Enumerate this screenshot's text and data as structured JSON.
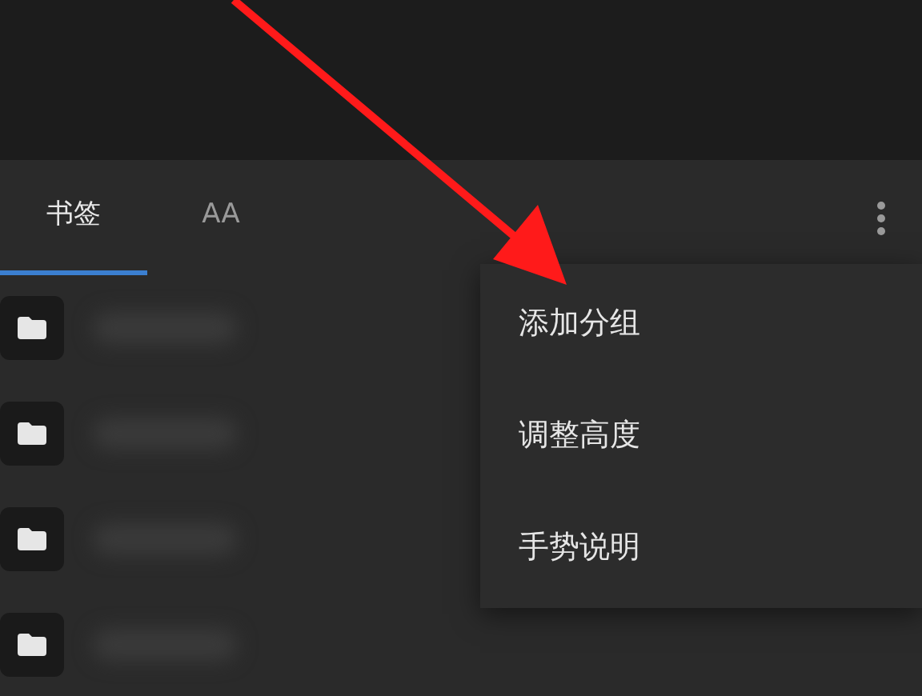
{
  "tabs": [
    {
      "label": "书签",
      "selected": true
    },
    {
      "label": "AA",
      "selected": false
    }
  ],
  "bookmarks": [
    {
      "kind": "folder"
    },
    {
      "kind": "folder"
    },
    {
      "kind": "folder"
    },
    {
      "kind": "folder"
    }
  ],
  "menu": {
    "items": [
      {
        "label": "添加分组"
      },
      {
        "label": "调整高度"
      },
      {
        "label": "手势说明"
      }
    ]
  }
}
